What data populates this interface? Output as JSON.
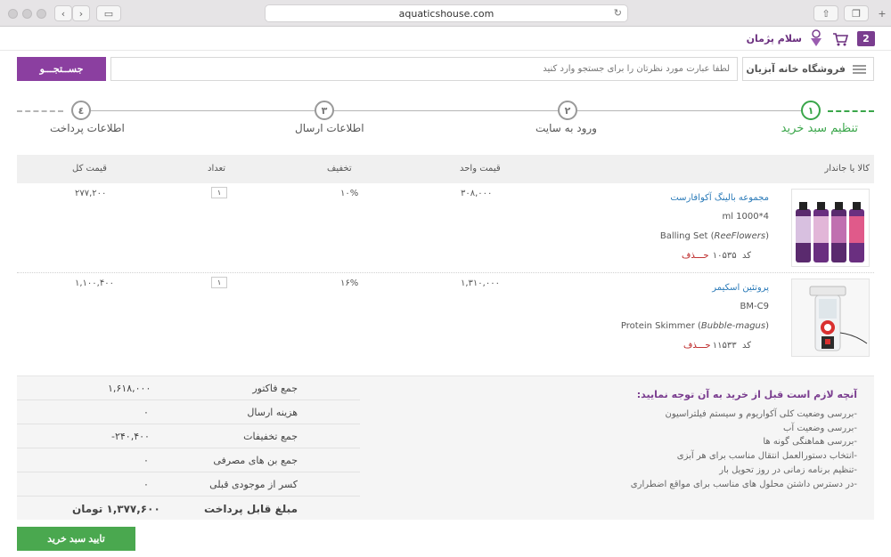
{
  "browser": {
    "url": "aquaticshouse.com"
  },
  "header": {
    "cart_count": "2",
    "greeting": "سلام پژمان"
  },
  "search": {
    "store_label": "فروشگاه خانه آبزیان",
    "placeholder": "لطفا عبارت مورد نظرتان را برای جستجو وارد کنید",
    "button_label": "جســتجـــو"
  },
  "steps": [
    {
      "num": "١",
      "label": "تنظیم سبد خرید",
      "active": true
    },
    {
      "num": "٢",
      "label": "ورود به سایت",
      "active": false
    },
    {
      "num": "٣",
      "label": "اطلاعات ارسال",
      "active": false
    },
    {
      "num": "٤",
      "label": "اطلاعات پرداخت",
      "active": false
    }
  ],
  "table": {
    "headers": {
      "item": "کالا یا جاندار",
      "unit_price": "قیمت واحد",
      "discount": "تخفیف",
      "qty": "تعداد",
      "total": "قیمت کل"
    },
    "rows": [
      {
        "name": "مجموعه بالینگ آکوافارست",
        "spec": "ml 1000*4",
        "latin_prefix": "Balling Set (",
        "latin_italic": "ReeFlowers",
        "latin_suffix": ")",
        "code_label": "کد",
        "code": "۱۰۵۳۵",
        "delete_label": "حـــذف",
        "unit_price": "۳۰۸,۰۰۰",
        "discount": "۱۰%",
        "qty": "۱",
        "total": "۲۷۷,۲۰۰"
      },
      {
        "name": "پروتئین اسکیمر",
        "spec": "BM-C9",
        "latin_prefix": "Protein Skimmer (",
        "latin_italic": "Bubble-magus",
        "latin_suffix": ")",
        "code_label": "کد",
        "code": "۱۱۵۳۳",
        "delete_label": "حـــذف",
        "unit_price": "۱,۳۱۰,۰۰۰",
        "discount": "۱۶%",
        "qty": "۱",
        "total": "۱,۱۰۰,۴۰۰"
      }
    ]
  },
  "summary": {
    "rows": [
      {
        "label": "جمع فاکتور",
        "value": "۱,۶۱۸,۰۰۰"
      },
      {
        "label": "هزینه ارسال",
        "value": "۰"
      },
      {
        "label": "جمع تخفیفات",
        "value": "-۲۴۰,۴۰۰"
      },
      {
        "label": "جمع بن های مصرفی",
        "value": "۰"
      },
      {
        "label": "کسر از موجودی قبلی",
        "value": "۰"
      }
    ],
    "payable_label": "مبلغ قابل پرداخت",
    "payable_value": "۱,۳۷۷,۶۰۰ تومان"
  },
  "notes": {
    "title": "آنچه لازم است قبل از خرید به آن توجه نمایید:",
    "items": [
      "-بررسی وضعیت کلی آکواریوم و سیستم فیلتراسیون",
      "-بررسی وضعیت آب",
      "-بررسی هماهنگی گونه ها",
      "-انتخاب دستورالعمل انتقال مناسب برای هر آبزی",
      "-تنظیم برنامه زمانی در روز تحویل بار",
      "-در دسترس داشتن محلول های مناسب برای مواقع اضطراری"
    ]
  },
  "confirm_button": "تایید سبد خرید",
  "colors": {
    "brand": "#8b3fa0",
    "active_step": "#3aa64a",
    "confirm": "#4aa84f",
    "link": "#2a7ab8"
  }
}
